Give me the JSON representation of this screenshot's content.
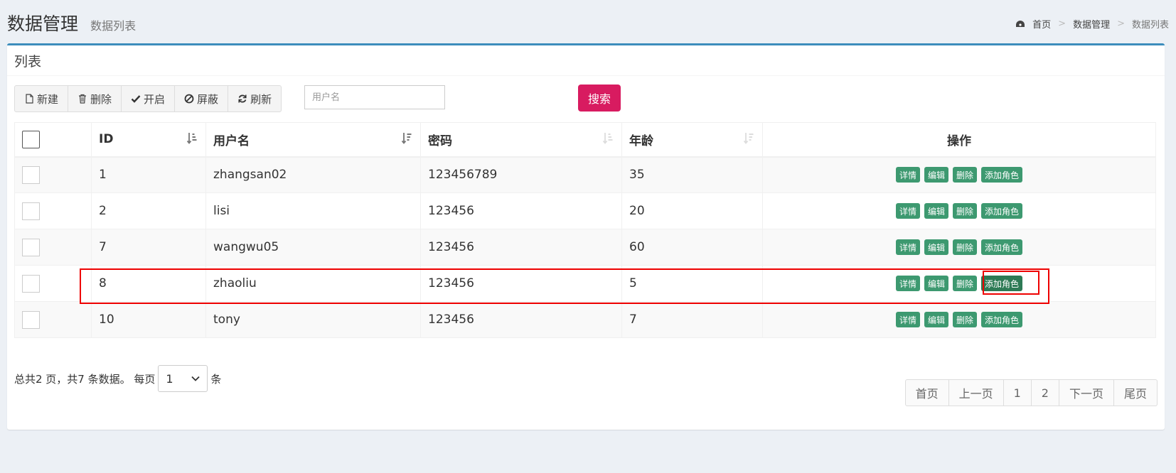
{
  "header": {
    "title": "数据管理",
    "subtitle": "数据列表",
    "breadcrumb": [
      "首页",
      "数据管理",
      "数据列表"
    ]
  },
  "box": {
    "title": "列表"
  },
  "toolbar": {
    "new_label": "新建",
    "delete_label": "删除",
    "enable_label": "开启",
    "block_label": "屏蔽",
    "refresh_label": "刷新"
  },
  "search": {
    "placeholder": "用户名",
    "button_label": "搜索"
  },
  "table": {
    "headers": {
      "id": "ID",
      "username": "用户名",
      "password": "密码",
      "age": "年龄",
      "ops": "操作"
    },
    "rows": [
      {
        "id": "1",
        "username": "zhangsan02",
        "password": "123456789",
        "age": "35"
      },
      {
        "id": "2",
        "username": "lisi",
        "password": "123456",
        "age": "20"
      },
      {
        "id": "7",
        "username": "wangwu05",
        "password": "123456",
        "age": "60"
      },
      {
        "id": "8",
        "username": "zhaoliu",
        "password": "123456",
        "age": "5"
      },
      {
        "id": "10",
        "username": "tony",
        "password": "123456",
        "age": "7"
      }
    ],
    "op_labels": {
      "detail": "详情",
      "edit": "编辑",
      "delete": "删除",
      "add_role": "添加角色"
    }
  },
  "footer": {
    "summary": "总共2 页，共7 条数据。 每页",
    "per_page_value": "1",
    "unit": "条"
  },
  "pagination": [
    "首页",
    "上一页",
    "1",
    "2",
    "下一页",
    "尾页"
  ],
  "colors": {
    "accent": "#3c8dbc",
    "search_button": "#d81b60",
    "op_button": "#3d9970",
    "highlight": "#e00000"
  }
}
